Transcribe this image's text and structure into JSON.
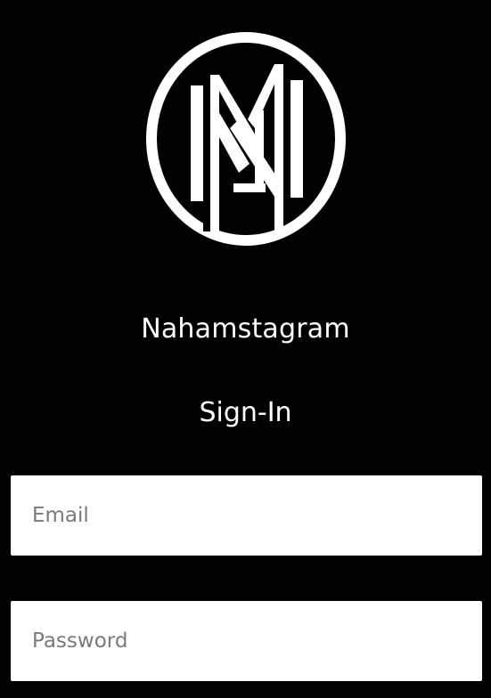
{
  "app": {
    "name": "Nahamstagram",
    "logo_icon": "nm-monogram-logo-icon"
  },
  "screen": {
    "title": "Sign-In"
  },
  "form": {
    "email": {
      "placeholder": "Email",
      "value": ""
    },
    "password": {
      "placeholder": "Password",
      "value": ""
    }
  },
  "colors": {
    "background": "#000000",
    "text": "#ffffff",
    "field_background": "#ffffff",
    "placeholder": "#7a7a7a"
  }
}
